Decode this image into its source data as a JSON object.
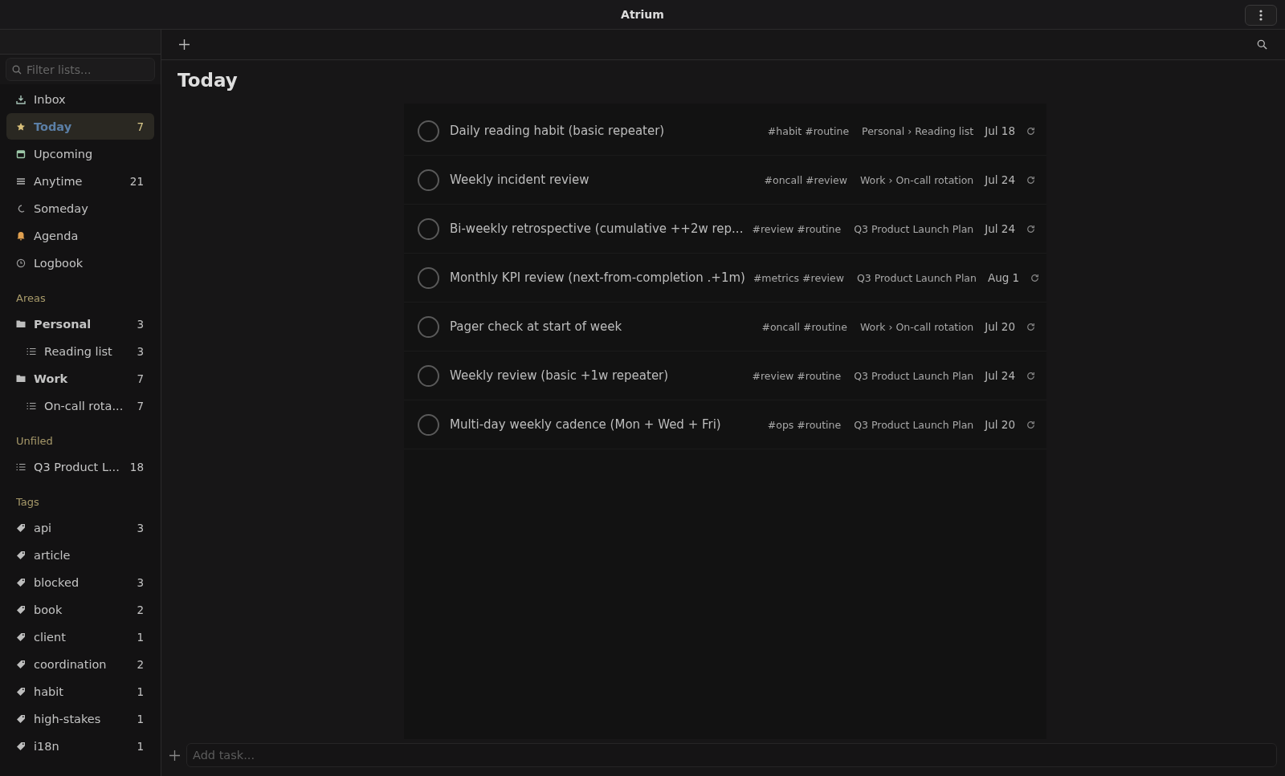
{
  "window": {
    "title": "Atrium"
  },
  "sidebar": {
    "filter": {
      "placeholder": "Filter lists..."
    },
    "nav": [
      {
        "kind": "inbox",
        "label": "Inbox",
        "selected": false
      },
      {
        "kind": "star",
        "label": "Today",
        "count": "7",
        "selected": true
      },
      {
        "kind": "calendar",
        "label": "Upcoming",
        "selected": false
      },
      {
        "kind": "lines",
        "label": "Anytime",
        "count": "21",
        "selected": false
      },
      {
        "kind": "moon",
        "label": "Someday",
        "selected": false
      },
      {
        "kind": "bell",
        "label": "Agenda",
        "selected": false
      },
      {
        "kind": "clock",
        "label": "Logbook",
        "selected": false
      }
    ],
    "areas": {
      "heading": "Areas",
      "items": [
        {
          "label": "Personal",
          "count": "3",
          "children": [
            {
              "label": "Reading list",
              "count": "3"
            }
          ]
        },
        {
          "label": "Work",
          "count": "7",
          "children": [
            {
              "label": "On-call rota...",
              "count": "7"
            }
          ]
        }
      ]
    },
    "unfiled": {
      "heading": "Unfiled",
      "items": [
        {
          "label": "Q3 Product L...",
          "count": "18"
        }
      ]
    },
    "tags": {
      "heading": "Tags",
      "items": [
        {
          "label": "api",
          "count": "3"
        },
        {
          "label": "article"
        },
        {
          "label": "blocked",
          "count": "3"
        },
        {
          "label": "book",
          "count": "2"
        },
        {
          "label": "client",
          "count": "1"
        },
        {
          "label": "coordination",
          "count": "2"
        },
        {
          "label": "habit",
          "count": "1"
        },
        {
          "label": "high-stakes",
          "count": "1"
        },
        {
          "label": "i18n",
          "count": "1"
        }
      ]
    }
  },
  "main": {
    "title": "Today",
    "tasks": [
      {
        "title": "Daily reading habit (basic repeater)",
        "tags": "#habit #routine",
        "project": "Personal › Reading list",
        "date": "Jul 18",
        "checked": false
      },
      {
        "title": "Weekly incident review",
        "tags": "#oncall #review",
        "project": "Work › On-call rotation",
        "date": "Jul 24",
        "checked": false
      },
      {
        "title": "Bi-weekly retrospective (cumulative ++2w rep...",
        "tags": "#review #routine",
        "project": "Q3 Product Launch Plan",
        "date": "Jul 24",
        "checked": false
      },
      {
        "title": "Monthly KPI review (next-from-completion .+1m)",
        "tags": "#metrics #review",
        "project": "Q3 Product Launch Plan",
        "date": "Aug 1",
        "checked": false
      },
      {
        "title": "Pager check at start of week",
        "tags": "#oncall #routine",
        "project": "Work › On-call rotation",
        "date": "Jul 20",
        "checked": false
      },
      {
        "title": "Weekly review (basic +1w repeater)",
        "tags": "#review #routine",
        "project": "Q3 Product Launch Plan",
        "date": "Jul 24",
        "checked": false
      },
      {
        "title": "Multi-day weekly cadence (Mon + Wed + Fri)",
        "tags": "#ops #routine",
        "project": "Q3 Product Launch Plan",
        "date": "Jul 20",
        "checked": false
      }
    ],
    "add_task": {
      "placeholder": "Add task..."
    }
  }
}
